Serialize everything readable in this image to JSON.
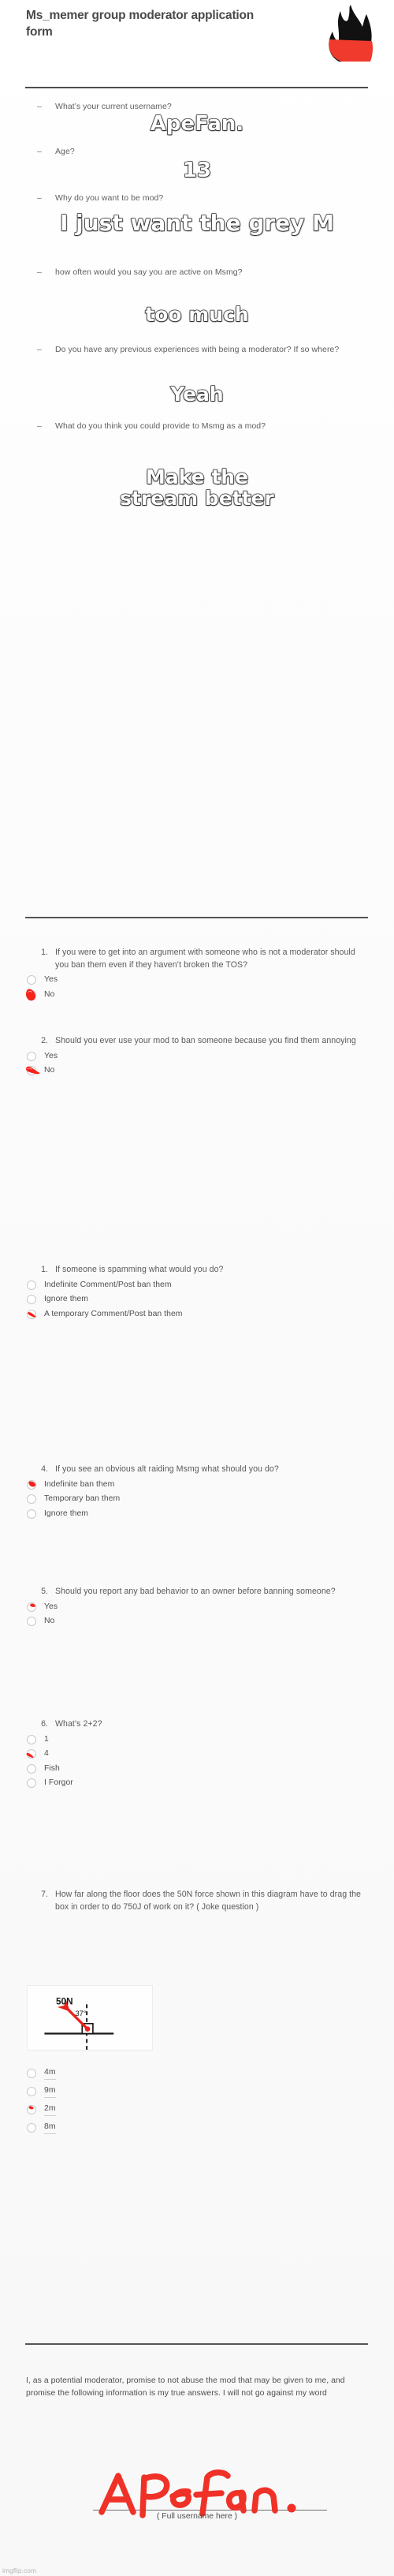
{
  "header": {
    "title": "Ms_memer group moderator application form",
    "logo_name": "flame-logo",
    "logo_colors": {
      "black": "#111111",
      "red": "#ef3a2d"
    }
  },
  "open_questions": [
    {
      "bullet": "–",
      "question": "What’s your current username?",
      "answer": "ApeFan.",
      "answer_size": 26
    },
    {
      "bullet": "–",
      "question": "Age?",
      "answer": "13",
      "answer_size": 26
    },
    {
      "bullet": "–",
      "question": "Why do you want to be mod?",
      "answer": "I just want the grey M",
      "answer_size": 28
    },
    {
      "bullet": "–",
      "question": "how often would you say you are active on Msmg?",
      "answer": "too much",
      "answer_size": 25
    },
    {
      "bullet": "–",
      "question": "Do you have any previous experiences with being a moderator? If so where?",
      "answer": "Yeah",
      "answer_size": 25
    },
    {
      "bullet": "–",
      "question": "What do you think you could provide to Msmg as a mod?",
      "answer": "Make the\nstream better",
      "answer_size": 25
    }
  ],
  "numbered_questions": [
    {
      "number": "1.",
      "text": "If you were to get into an argument with someone who is not a moderator should you ban them even if they haven’t broken the TOS?",
      "options": [
        {
          "label": "Yes",
          "marked": false,
          "mark_style": "none"
        },
        {
          "label": "No",
          "marked": true,
          "mark_style": "blob-filled"
        }
      ]
    },
    {
      "number": "2.",
      "text": "Should you ever use your mod to ban someone because you find them annoying",
      "options": [
        {
          "label": "Yes",
          "marked": false,
          "mark_style": "none"
        },
        {
          "label": "No",
          "marked": true,
          "mark_style": "swoosh"
        }
      ]
    },
    {
      "number": "1.",
      "text": "If someone is spamming what would you do?",
      "options": [
        {
          "label": "Indefinite Comment/Post ban them",
          "marked": false,
          "mark_style": "none"
        },
        {
          "label": "Ignore them",
          "marked": false,
          "mark_style": "none"
        },
        {
          "label": "A temporary Comment/Post ban them",
          "marked": true,
          "mark_style": "slash"
        }
      ]
    },
    {
      "number": "4.",
      "text": "If you see an obvious alt raiding Msmg what should you do?",
      "options": [
        {
          "label": "Indefinite ban them",
          "marked": true,
          "mark_style": "blob"
        },
        {
          "label": "Temporary ban them",
          "marked": false,
          "mark_style": "none"
        },
        {
          "label": "Ignore them",
          "marked": false,
          "mark_style": "none"
        }
      ]
    },
    {
      "number": "5.",
      "text": "Should you report any bad behavior to an owner before banning someone?",
      "options": [
        {
          "label": "Yes",
          "marked": true,
          "mark_style": "tick"
        },
        {
          "label": "No",
          "marked": false,
          "mark_style": "none"
        }
      ]
    },
    {
      "number": "6.",
      "text": "What’s 2+2?",
      "options": [
        {
          "label": "1",
          "marked": false,
          "mark_style": "none"
        },
        {
          "label": "4",
          "marked": true,
          "mark_style": "dash"
        },
        {
          "label": "Fish",
          "marked": false,
          "mark_style": "none"
        },
        {
          "label": "I Forgor",
          "marked": false,
          "mark_style": "none"
        }
      ]
    },
    {
      "number": "7.",
      "text": "How far along the floor does the 50N force shown in this diagram have to drag the box in order to do 750J of work on it? ( Joke question )",
      "diagram": {
        "name": "physics-force-diagram",
        "force_label": "50N",
        "angle_label": "37°",
        "arrow_color": "#e8231e",
        "line_color": "#1a1a1a"
      },
      "options": [
        {
          "label": "4m",
          "marked": false,
          "mark_style": "none",
          "underline": true
        },
        {
          "label": "9m",
          "marked": false,
          "mark_style": "none",
          "underline": true
        },
        {
          "label": "2m",
          "marked": true,
          "mark_style": "blob",
          "underline": true
        },
        {
          "label": "8m",
          "marked": false,
          "mark_style": "none",
          "underline": true
        }
      ]
    }
  ],
  "pledge": {
    "text": "I, as a potential moderator, promise to not abuse the mod that may be given to me, and promise the following information is my true answers. I will not go against my word",
    "signature_text": "ApeFan.",
    "signature_color": "#f03127",
    "caption": "( Full username here )"
  },
  "watermark": "imgflip.com"
}
